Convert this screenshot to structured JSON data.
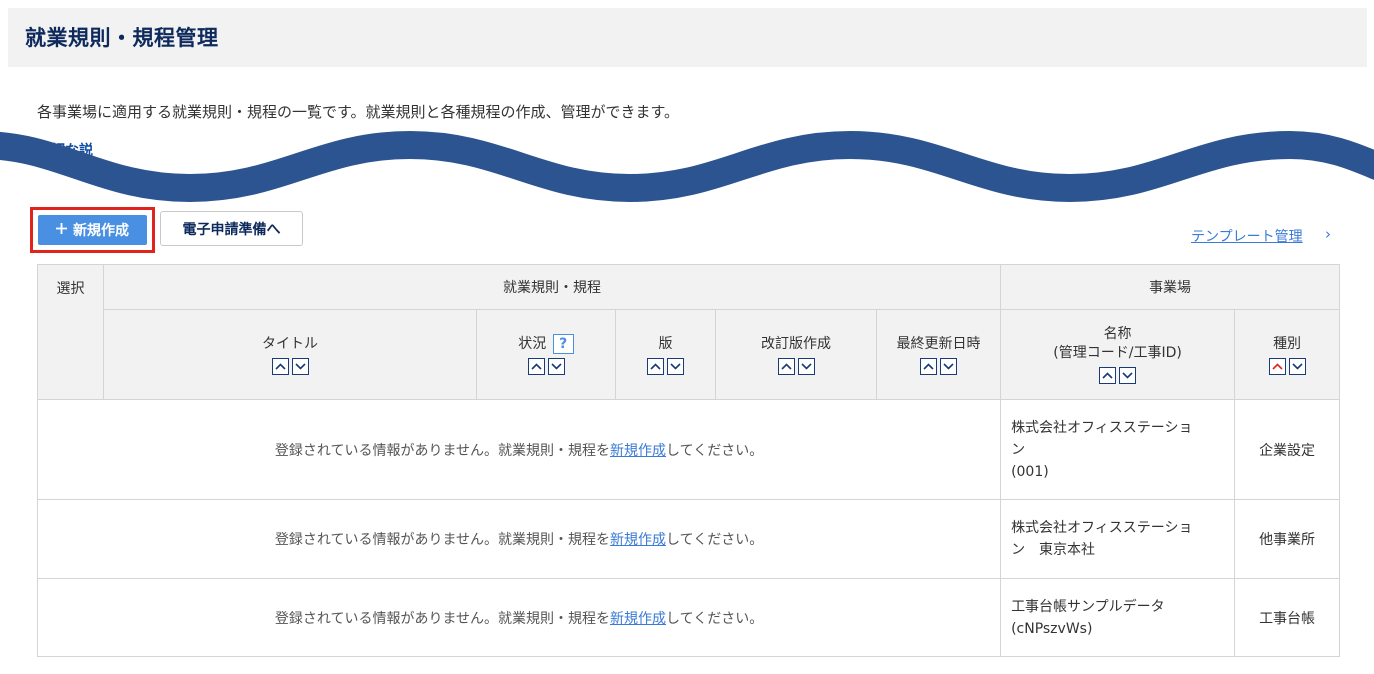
{
  "header": {
    "title": "就業規則・規程管理"
  },
  "intro": {
    "description": "各事業場に適用する就業規則・規程の一覧です。就業規則と各種規程の作成、管理ができます。",
    "detail_link": "詳細な説"
  },
  "toolbar": {
    "new_button": "新規作成",
    "new_icon": "plus-icon",
    "e_apply_button": "電子申請準備へ",
    "template_link": "テンプレート管理",
    "template_chevron": "›"
  },
  "table": {
    "select_header": "選択",
    "group_rules": "就業規則・規程",
    "group_office": "事業場",
    "columns": {
      "title": "タイトル",
      "status": "状況",
      "status_help": "?",
      "version": "版",
      "revision": "改訂版作成",
      "updated": "最終更新日時",
      "office_name_1": "名称",
      "office_name_2": "(管理コード/工事ID)",
      "office_type": "種別"
    },
    "empty_message": {
      "before": "登録されている情報がありません。就業規則・規程を",
      "link": "新規作成",
      "after": "してください。"
    },
    "rows": [
      {
        "name_lines": [
          "株式会社オフィスステーショ",
          "ン",
          "(001)"
        ],
        "type": "企業設定"
      },
      {
        "name_lines": [
          "株式会社オフィスステーショ",
          "ン　東京本社"
        ],
        "type": "他事業所"
      },
      {
        "name_lines": [
          "工事台帳サンプルデータ",
          "(cNPszvWs)"
        ],
        "type": "工事台帳"
      }
    ]
  },
  "colors": {
    "primary": "#4a90e2",
    "title": "#0e2a5c",
    "highlight": "#e1231e",
    "wave": "#2c5491",
    "active_sort": "#e1231e"
  }
}
